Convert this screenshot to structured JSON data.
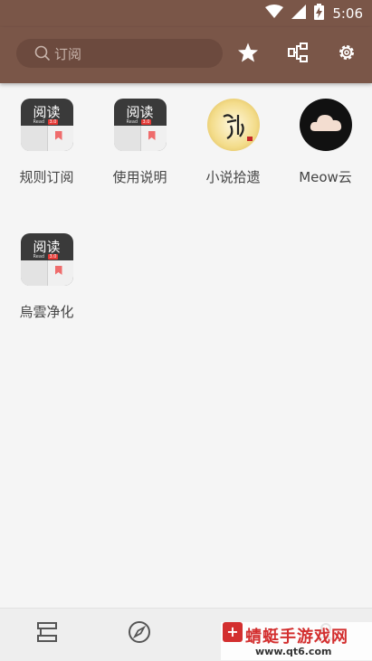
{
  "status_bar": {
    "time": "5:06",
    "icons": [
      "wifi-icon",
      "signal-icon",
      "battery-charging-icon"
    ]
  },
  "app_bar": {
    "search_placeholder": "订阅",
    "actions": [
      "star-icon",
      "rule-tree-icon",
      "gear-icon"
    ]
  },
  "subscriptions": [
    {
      "label": "规则订阅",
      "icon": "legado-book-icon",
      "icon_text": "阅读",
      "icon_sub": "Read",
      "icon_badge": "3.0"
    },
    {
      "label": "使用说明",
      "icon": "legado-book-icon",
      "icon_text": "阅读",
      "icon_sub": "Read",
      "icon_badge": "3.0"
    },
    {
      "label": "小说拾遗",
      "icon": "calligraphy-logo-icon"
    },
    {
      "label": "Meow云",
      "icon": "cloud-logo-icon"
    },
    {
      "label": "烏雲净化",
      "icon": "legado-book-icon",
      "icon_text": "阅读",
      "icon_sub": "Read",
      "icon_badge": "3.0"
    }
  ],
  "bottom_nav": [
    "bookshelf-icon",
    "compass-icon",
    "rss-icon",
    "profile-icon"
  ],
  "watermark": {
    "text": "蜻蜓手游戏网",
    "url": "www.qt6.com",
    "badge": "+"
  },
  "colors": {
    "app_bar": "#7a5648",
    "background": "#f5f5f5",
    "accent": "#e53935"
  }
}
